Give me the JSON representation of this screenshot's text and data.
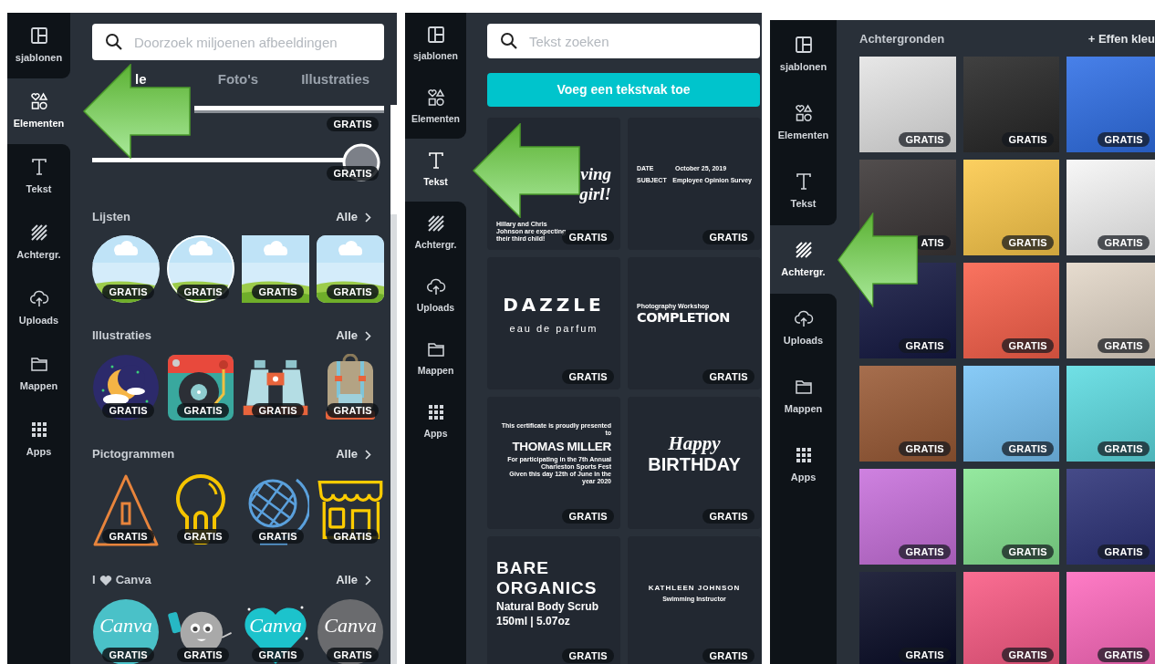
{
  "panels": [
    {
      "kind": "elements",
      "sidebar": [
        {
          "kind": "templates",
          "label": "sjablonen",
          "selected": false
        },
        {
          "kind": "elements",
          "label": "Elementen",
          "selected": true
        },
        {
          "kind": "text",
          "label": "Tekst",
          "selected": false
        },
        {
          "kind": "backgrounds",
          "label": "Achtergr.",
          "selected": false
        },
        {
          "kind": "uploads",
          "label": "Uploads",
          "selected": false
        },
        {
          "kind": "folders",
          "label": "Mappen",
          "selected": false
        },
        {
          "kind": "apps",
          "label": "Apps",
          "selected": false
        }
      ],
      "search": {
        "placeholder": "Doorzoek miljoenen afbeeldingen"
      },
      "tabs": [
        {
          "label": "le",
          "selected": true
        },
        {
          "label": "Foto's",
          "selected": false
        },
        {
          "label": "Illustraties",
          "selected": false
        }
      ],
      "shapes": [
        {
          "kind": "line",
          "badge": "GRATIS"
        },
        {
          "kind": "line-circle",
          "badge": "GRATIS"
        }
      ],
      "sections": [
        {
          "kind": "frames",
          "title": "Lijsten",
          "link": "Alle",
          "items": [
            {
              "kind": "circle-frame",
              "badge": "GRATIS"
            },
            {
              "kind": "ring-frame",
              "badge": "GRATIS"
            },
            {
              "kind": "square-frame",
              "badge": "GRATIS"
            },
            {
              "kind": "rounded-frame",
              "badge": "GRATIS"
            }
          ]
        },
        {
          "kind": "illustrations",
          "title": "Illustraties",
          "link": "Alle",
          "items": [
            {
              "kind": "moon",
              "badge": "GRATIS"
            },
            {
              "kind": "turntable",
              "badge": "GRATIS"
            },
            {
              "kind": "binoculars",
              "badge": "GRATIS"
            },
            {
              "kind": "backpack",
              "badge": "GRATIS"
            }
          ]
        },
        {
          "kind": "pictograms",
          "title": "Pictogrammen",
          "link": "Alle",
          "items": [
            {
              "kind": "warning",
              "badge": "GRATIS"
            },
            {
              "kind": "bulb",
              "badge": "GRATIS"
            },
            {
              "kind": "globe",
              "badge": "GRATIS"
            },
            {
              "kind": "shop",
              "badge": "GRATIS"
            }
          ]
        },
        {
          "kind": "stickers",
          "title": "I",
          "title_suffix": "Canva",
          "link": "Alle",
          "items": [
            {
              "kind": "sticker-circle",
              "text": "Canva",
              "badge": "GRATIS"
            },
            {
              "kind": "monster",
              "badge": "GRATIS"
            },
            {
              "kind": "sticker-heart",
              "text": "Canva",
              "badge": "GRATIS"
            },
            {
              "kind": "sticker-grey",
              "text": "Canva",
              "badge": "GRATIS"
            }
          ]
        }
      ]
    },
    {
      "kind": "text",
      "sidebar": [
        {
          "kind": "templates",
          "label": "sjablonen",
          "selected": false
        },
        {
          "kind": "elements",
          "label": "Elementen",
          "selected": false
        },
        {
          "kind": "text",
          "label": "Tekst",
          "selected": true
        },
        {
          "kind": "backgrounds",
          "label": "Achtergr.",
          "selected": false
        },
        {
          "kind": "uploads",
          "label": "Uploads",
          "selected": false
        },
        {
          "kind": "folders",
          "label": "Mappen",
          "selected": false
        },
        {
          "kind": "apps",
          "label": "Apps",
          "selected": false
        }
      ],
      "search": {
        "placeholder": "Tekst zoeken"
      },
      "button": "Voeg een tekstvak toe",
      "cards": [
        {
          "badge": "GRATIS",
          "lines": [
            {
              "kind": "script-right",
              "text": "ving"
            },
            {
              "kind": "script-right",
              "text": "girl!"
            },
            {
              "kind": "tiny-low",
              "text": "Hillary and Chris Johnson are expecting their third child!"
            }
          ]
        },
        {
          "badge": "GRATIS",
          "lines": [
            {
              "kind": "pair",
              "text": "DATE",
              "value": "October 25, 2019"
            },
            {
              "kind": "pair",
              "text": "SUBJECT",
              "value": "Employee Opinion Survey"
            }
          ]
        },
        {
          "badge": "GRATIS",
          "lines": [
            {
              "kind": "display-spaced",
              "text": "DAZZLE"
            },
            {
              "kind": "spaced",
              "text": "eau de parfum"
            }
          ]
        },
        {
          "badge": "GRATIS",
          "lines": [
            {
              "kind": "label-small",
              "text": "Photography Workshop"
            },
            {
              "kind": "heavy",
              "text": "COMPLETION"
            }
          ]
        },
        {
          "badge": "GRATIS",
          "lines": [
            {
              "kind": "tiny-right",
              "text": "This certificate is proudly presented to"
            },
            {
              "kind": "condensed",
              "text": "THOMAS MILLER"
            },
            {
              "kind": "tiny-right",
              "text": "For participating in the 7th Annual Charleston Sports Fest"
            },
            {
              "kind": "tiny-right",
              "text": "Given this day 12th of June in the year 2020"
            }
          ]
        },
        {
          "badge": "GRATIS",
          "lines": [
            {
              "kind": "script-center",
              "text": "Happy"
            },
            {
              "kind": "big-bold",
              "text": "BIRTHDAY"
            }
          ]
        },
        {
          "badge": "GRATIS",
          "lines": [
            {
              "kind": "block-bold",
              "text": "BARE"
            },
            {
              "kind": "block-bold",
              "text": "ORGANICS"
            },
            {
              "kind": "medium",
              "text": "Natural Body Scrub"
            },
            {
              "kind": "medium",
              "text": "150ml | 5.07oz"
            }
          ]
        },
        {
          "badge": "GRATIS",
          "lines": [
            {
              "kind": "caps-spaced",
              "text": "KATHLEEN JOHNSON"
            },
            {
              "kind": "tiny-center",
              "text": "Swimming Instructor"
            }
          ]
        }
      ]
    },
    {
      "kind": "backgrounds",
      "sidebar": [
        {
          "kind": "templates",
          "label": "sjablonen",
          "selected": false
        },
        {
          "kind": "elements",
          "label": "Elementen",
          "selected": false
        },
        {
          "kind": "text",
          "label": "Tekst",
          "selected": false
        },
        {
          "kind": "backgrounds",
          "label": "Achtergr.",
          "selected": true
        },
        {
          "kind": "uploads",
          "label": "Uploads",
          "selected": false
        },
        {
          "kind": "folders",
          "label": "Mappen",
          "selected": false
        },
        {
          "kind": "apps",
          "label": "Apps",
          "selected": false
        }
      ],
      "header": {
        "title": "Achtergronden",
        "action": "+ Effen kleu"
      },
      "tiles": [
        {
          "color": "#e4e4e4",
          "badge": "GRATIS"
        },
        {
          "color": "#262626",
          "badge": "GRATIS"
        },
        {
          "color": "#2f6fe6",
          "badge": "GRATIS"
        },
        {
          "color": "#3a3535",
          "badge": "ATIS"
        },
        {
          "color": "#fcc94a",
          "badge": "GRATIS"
        },
        {
          "color": "#f6f6f6",
          "badge": "GRATIS"
        },
        {
          "color": "#141842",
          "badge": "GRATIS"
        },
        {
          "color": "#f9604a",
          "badge": "GRATIS"
        },
        {
          "color": "#e3d7c8",
          "badge": "GRATIS"
        },
        {
          "color": "#9a5a35",
          "badge": "GRATIS"
        },
        {
          "color": "#78c4f6",
          "badge": "GRATIS"
        },
        {
          "color": "#5ddce2",
          "badge": "GRATIS"
        },
        {
          "color": "#c870dc",
          "badge": "GRATIS"
        },
        {
          "color": "#86e692",
          "badge": "GRATIS"
        },
        {
          "color": "#2c3278",
          "badge": "GRATIS"
        },
        {
          "color": "#080b26",
          "badge": "GRATIS"
        },
        {
          "color": "#fa5a84",
          "badge": "GRATIS"
        },
        {
          "color": "#ff6abe",
          "badge": "GRATIS"
        }
      ]
    }
  ]
}
